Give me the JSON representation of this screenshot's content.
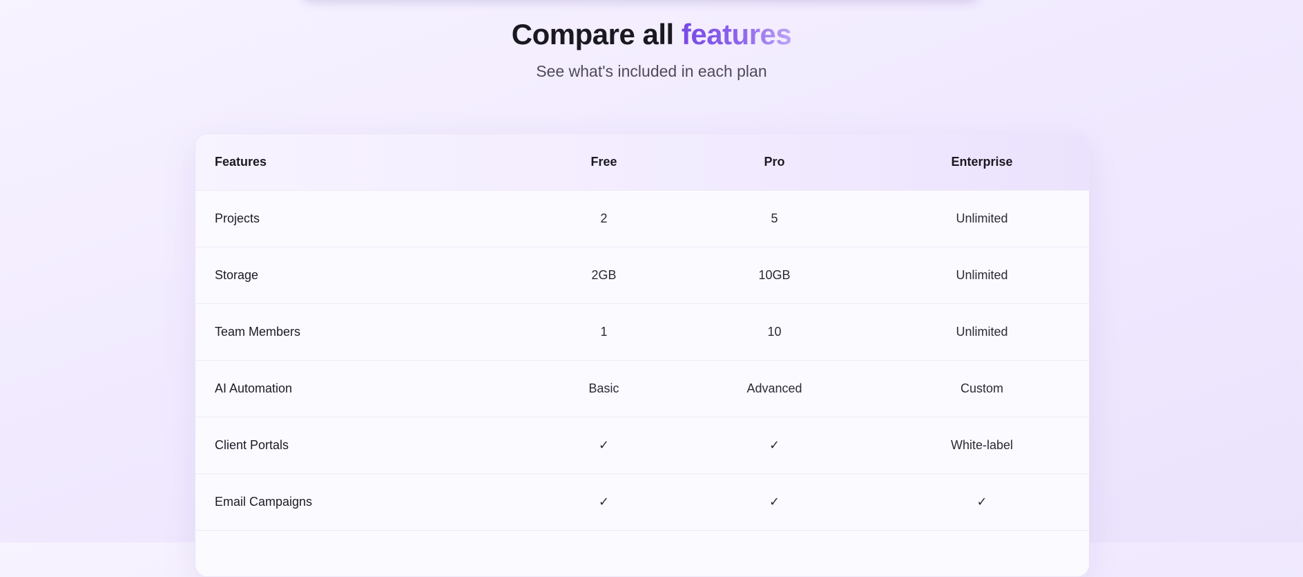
{
  "header": {
    "title_main": "Compare all",
    "title_accent": "features",
    "subtitle": "See what's included in each plan"
  },
  "table": {
    "columns": [
      "Features",
      "Free",
      "Pro",
      "Enterprise"
    ],
    "rows": [
      {
        "feature": "Projects",
        "free": "2",
        "pro": "5",
        "enterprise": "Unlimited"
      },
      {
        "feature": "Storage",
        "free": "2GB",
        "pro": "10GB",
        "enterprise": "Unlimited"
      },
      {
        "feature": "Team Members",
        "free": "1",
        "pro": "10",
        "enterprise": "Unlimited"
      },
      {
        "feature": "AI Automation",
        "free": "Basic",
        "pro": "Advanced",
        "enterprise": "Custom"
      },
      {
        "feature": "Client Portals",
        "free": "✓",
        "pro": "✓",
        "enterprise": "White-label"
      },
      {
        "feature": "Email Campaigns",
        "free": "✓",
        "pro": "✓",
        "enterprise": "✓"
      }
    ]
  },
  "colors": {
    "accent": "#7848e4",
    "accent_light": "#bba4f6",
    "background": "#f1eaff",
    "text": "#1c1a24"
  }
}
